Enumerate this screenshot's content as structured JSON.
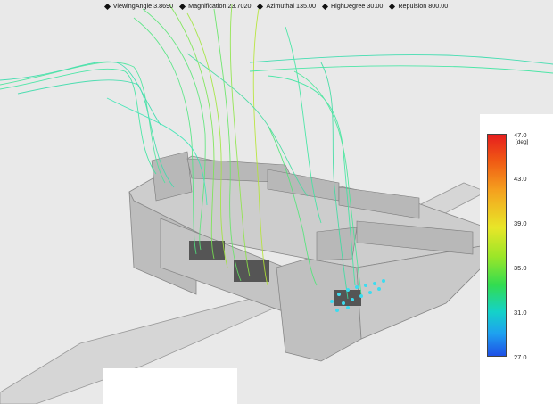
{
  "hud": {
    "viewing_angle": "ViewingAngle 3.8690",
    "magnification": "Magnification 23.7020",
    "azimuthal": "Azimuthal 135.00",
    "high_degree": "HighDegree 30.00",
    "repulsion": "Repulsion 800.00"
  },
  "legend": {
    "unit": "[deg]",
    "ticks": [
      "47.0",
      "43.0",
      "39.0",
      "35.0",
      "31.0",
      "27.0"
    ],
    "colors": {
      "high": "#e61e1e",
      "mid_high": "#f5a01e",
      "mid": "#e8e628",
      "mid_low": "#32dc50",
      "low_cyan": "#14d2c8",
      "low": "#1e50e6"
    }
  },
  "scene": {
    "streamline_color": "#3ce6a0",
    "structure_color": "#c8c8c8"
  }
}
